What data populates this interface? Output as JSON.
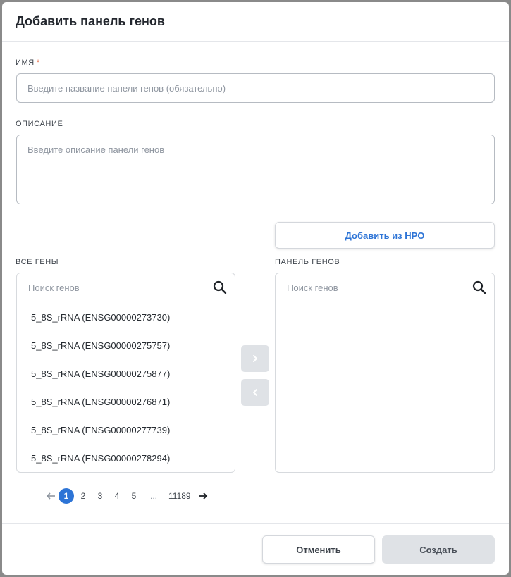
{
  "modal": {
    "title": "Добавить панель генов"
  },
  "form": {
    "name_label": "Имя",
    "name_required_mark": "*",
    "name_placeholder": "Введите название панели генов (обязательно)",
    "name_value": "",
    "description_label": "Описание",
    "description_placeholder": "Введите описание панели генов",
    "description_value": ""
  },
  "hpo_button_label": "Добавить из HPO",
  "all_genes": {
    "label": "Все гены",
    "search_placeholder": "Поиск генов",
    "items": [
      "5_8S_rRNA (ENSG00000273730)",
      "5_8S_rRNA (ENSG00000275757)",
      "5_8S_rRNA (ENSG00000275877)",
      "5_8S_rRNA (ENSG00000276871)",
      "5_8S_rRNA (ENSG00000277739)",
      "5_8S_rRNA (ENSG00000278294)"
    ]
  },
  "gene_panel": {
    "label": "Панель генов",
    "search_placeholder": "Поиск генов",
    "items": []
  },
  "transfer": {
    "add_icon": "chevron-right-icon",
    "remove_icon": "chevron-left-icon"
  },
  "pagination": {
    "pages": [
      "1",
      "2",
      "3",
      "4",
      "5"
    ],
    "ellipsis": "...",
    "last_page": "11189",
    "current": "1"
  },
  "footer": {
    "cancel_label": "Отменить",
    "create_label": "Создать"
  },
  "colors": {
    "accent": "#2d74d6",
    "required": "#e8643c",
    "disabled_button": "#dfe2e6"
  }
}
